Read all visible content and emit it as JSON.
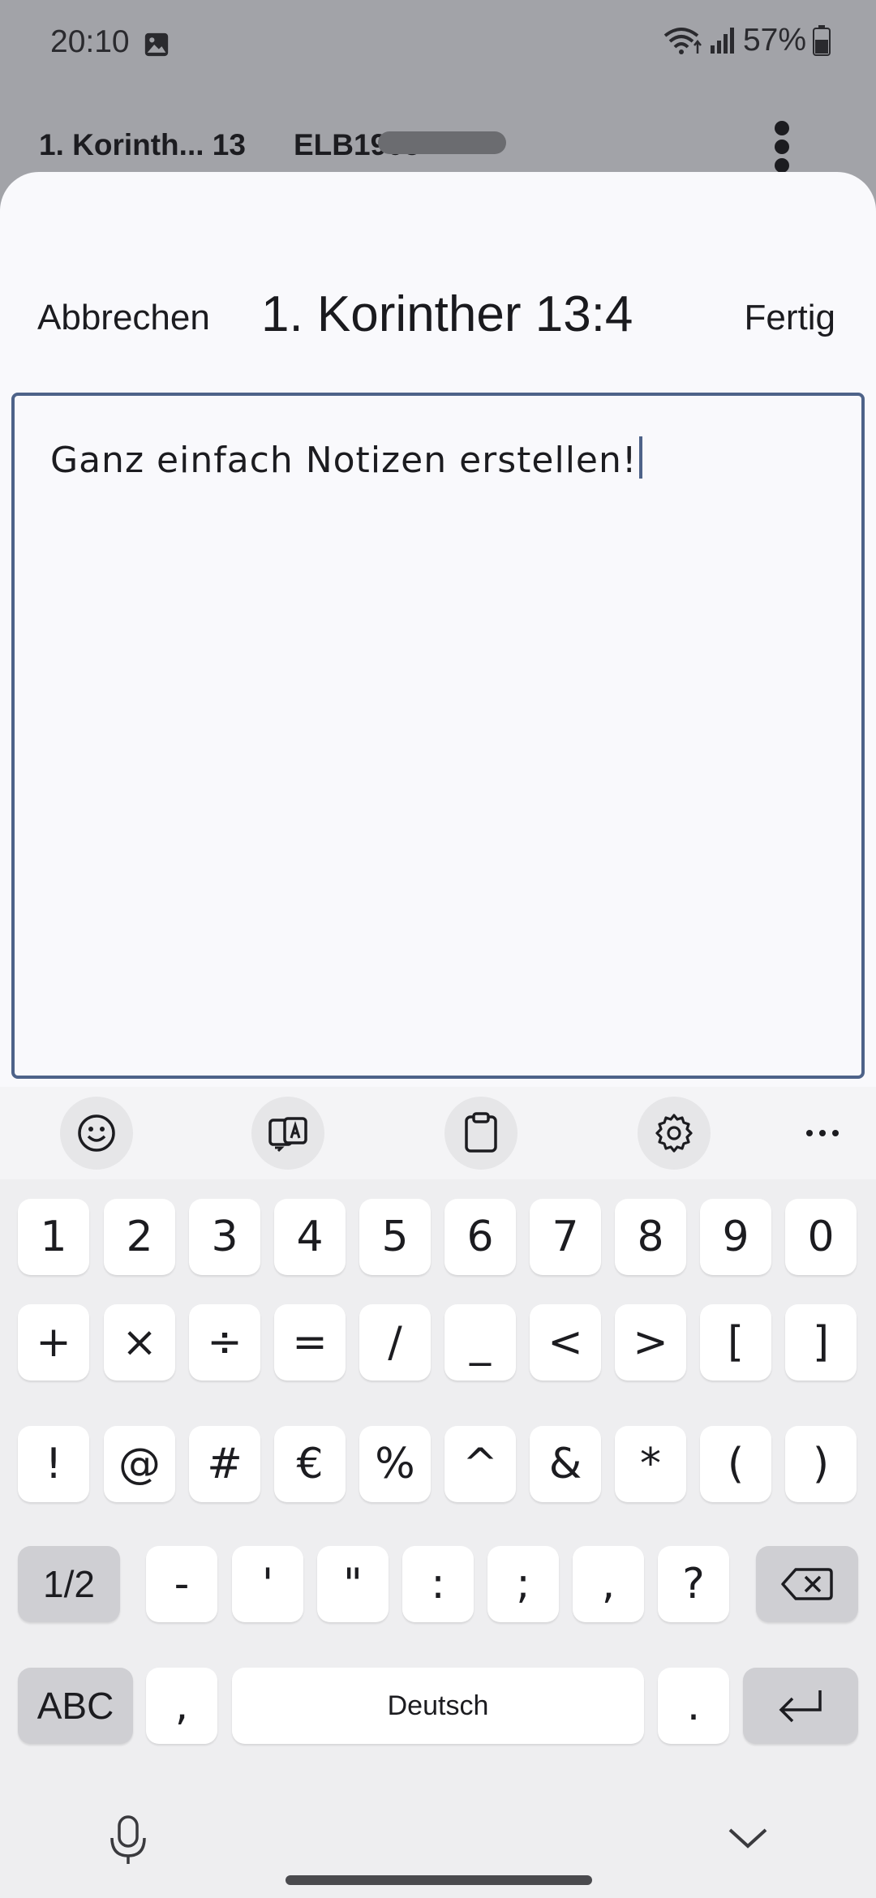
{
  "status_bar": {
    "time": "20:10",
    "image_icon": "image-icon",
    "wifi_icon": "wifi-icon",
    "signal_icon": "signal-icon",
    "battery_percent": "57%",
    "battery_icon": "battery-icon"
  },
  "background_app": {
    "book": "1. Korinth... 13",
    "translation": "ELB1905"
  },
  "sheet": {
    "cancel_label": "Abbrechen",
    "title": "1. Korinther 13:4",
    "done_label": "Fertig",
    "note_text": "Ganz einfach Notizen erstellen!"
  },
  "keyboard": {
    "toolbar": [
      "emoji-icon",
      "translate-icon",
      "clipboard-icon",
      "settings-icon",
      "more-icon"
    ],
    "row1": [
      "1",
      "2",
      "3",
      "4",
      "5",
      "6",
      "7",
      "8",
      "9",
      "0"
    ],
    "row2": [
      "+",
      "×",
      "÷",
      "=",
      "/",
      "_",
      "<",
      ">",
      "[",
      "]"
    ],
    "row3": [
      "!",
      "@",
      "#",
      "€",
      "%",
      "^",
      "&",
      "*",
      "(",
      ")"
    ],
    "row4": {
      "shift_label": "1/2",
      "keys": [
        "-",
        "'",
        "\"",
        ":",
        ";",
        ",",
        "?"
      ]
    },
    "row5": {
      "mode_label": "ABC",
      "comma": ",",
      "space_label": "Deutsch",
      "period": "."
    }
  },
  "colors": {
    "accent": "#4e6389",
    "sheet_bg": "#f9f9fc",
    "scrim": "#a2a3a8",
    "key_bg": "#ffffff",
    "function_key_bg": "#cfcfd3"
  }
}
